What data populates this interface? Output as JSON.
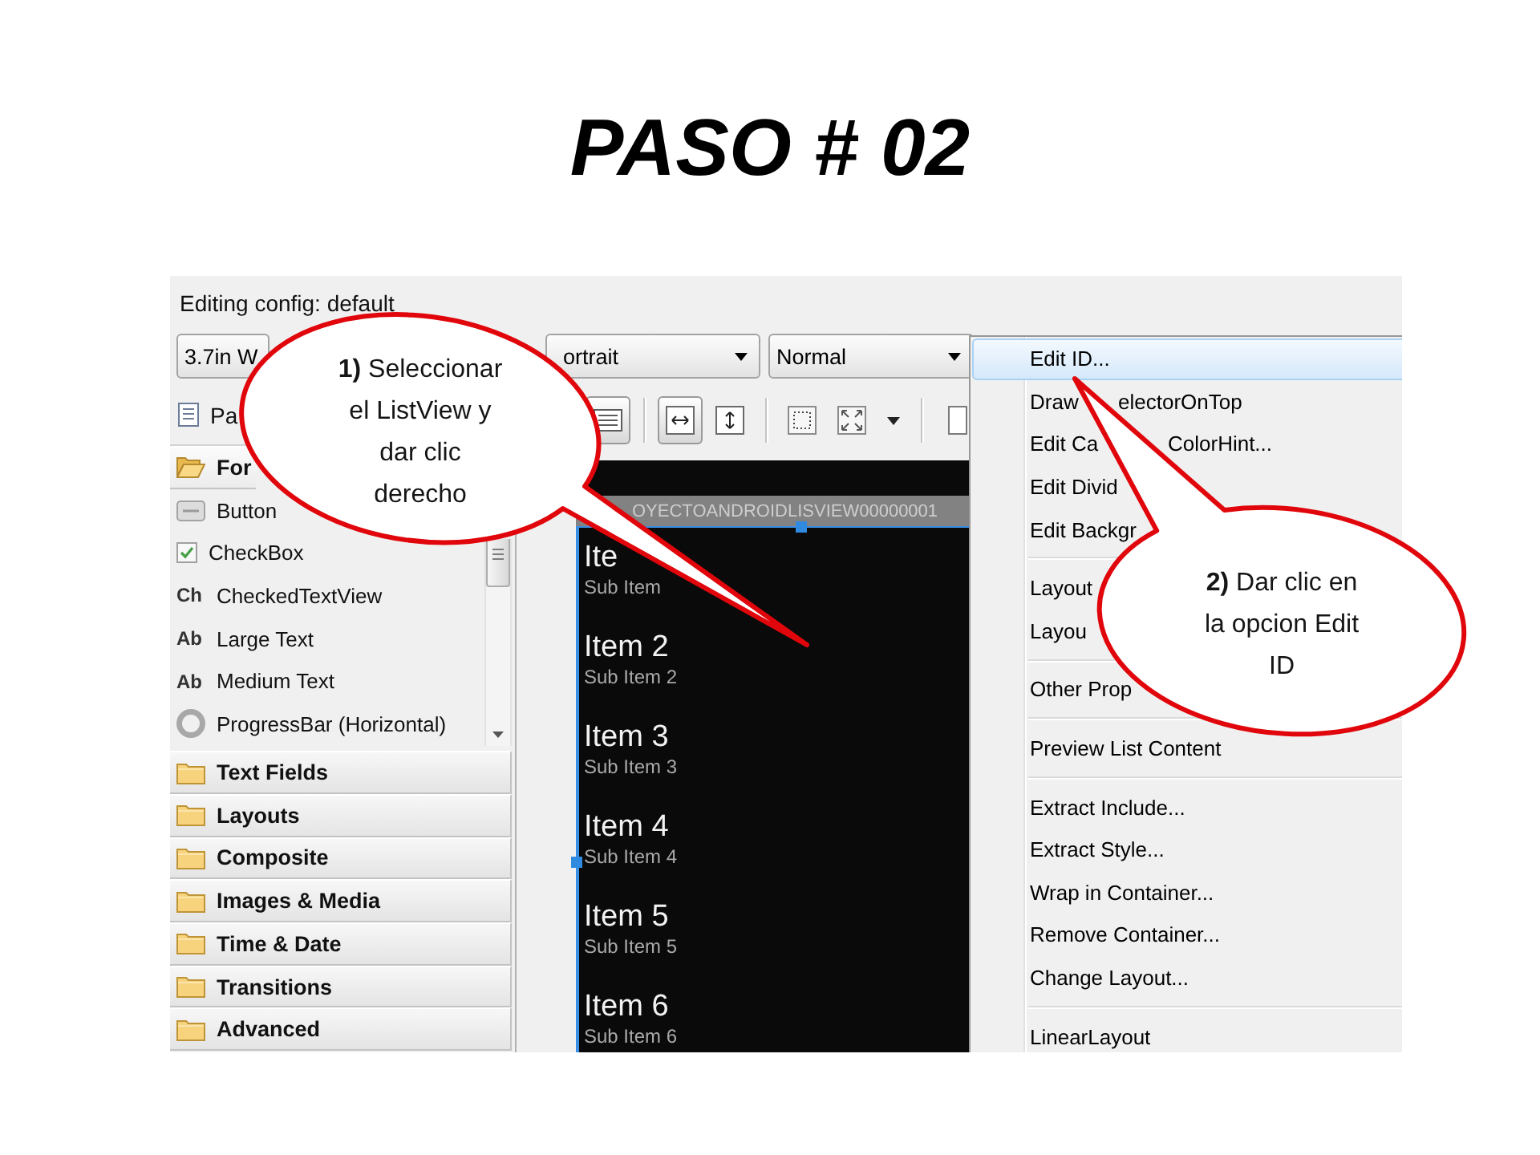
{
  "slide_title": "PASO # 02",
  "editor": {
    "config_label": "Editing config: default",
    "combos": [
      {
        "value": "3.7in W",
        "caret": false
      },
      {
        "value": "ortrait",
        "caret": true
      },
      {
        "value": "Normal",
        "caret": true
      }
    ],
    "palette": {
      "title": "Pa",
      "categories": [
        {
          "label": "For",
          "expanded": true,
          "items": [
            {
              "kind": "button",
              "label": "Button"
            },
            {
              "kind": "checkbox",
              "label": "CheckBox"
            },
            {
              "kind": "glyph",
              "icon_text": "Ch",
              "label": "CheckedTextView"
            },
            {
              "kind": "glyph",
              "icon_text": "Ab",
              "label": "Large Text"
            },
            {
              "kind": "glyph",
              "icon_text": "Ab",
              "label": "Medium Text"
            },
            {
              "kind": "ring",
              "label": "ProgressBar (Horizontal)"
            }
          ]
        },
        {
          "label": "Text Fields",
          "expanded": false
        },
        {
          "label": "Layouts",
          "expanded": false
        },
        {
          "label": "Composite",
          "expanded": false
        },
        {
          "label": "Images & Media",
          "expanded": false
        },
        {
          "label": "Time & Date",
          "expanded": false
        },
        {
          "label": "Transitions",
          "expanded": false
        },
        {
          "label": "Advanced",
          "expanded": false
        }
      ]
    },
    "toolbar": {
      "groups": [
        {
          "buttons": [
            {
              "kind": "list",
              "pressed": true
            }
          ]
        },
        {
          "buttons": [
            {
              "kind": "fit-width",
              "pressed": true
            },
            {
              "kind": "fit-height",
              "pressed": false
            }
          ]
        },
        {
          "buttons": [
            {
              "kind": "marquee",
              "pressed": false
            },
            {
              "kind": "expand",
              "pressed": false
            },
            {
              "kind": "caret",
              "pressed": false
            }
          ]
        },
        {
          "buttons": [
            {
              "kind": "frame",
              "pressed": false
            }
          ]
        }
      ]
    },
    "screen": {
      "title": "OYECTOANDROIDLISVIEW00000001",
      "list": {
        "selected": true,
        "items": [
          {
            "title": "Ite",
            "subtitle": "Sub Item"
          },
          {
            "title": "Item 2",
            "subtitle": "Sub Item 2"
          },
          {
            "title": "Item 3",
            "subtitle": "Sub Item 3"
          },
          {
            "title": "Item 4",
            "subtitle": "Sub Item 4"
          },
          {
            "title": "Item 5",
            "subtitle": "Sub Item 5"
          },
          {
            "title": "Item 6",
            "subtitle": "Sub Item 6"
          }
        ]
      }
    },
    "context_menu": {
      "items": [
        {
          "kind": "item",
          "label": "Edit ID...",
          "selected": true
        },
        {
          "kind": "item",
          "label": "Draw",
          "label_after": "electorOnTop",
          "selected": false
        },
        {
          "kind": "item",
          "label": "Edit Ca",
          "label_after": "ColorHint...",
          "selected": false
        },
        {
          "kind": "item",
          "label": "Edit Divid",
          "selected": false
        },
        {
          "kind": "item",
          "label": "Edit Backgr",
          "selected": false
        },
        {
          "kind": "separator"
        },
        {
          "kind": "item",
          "label": "Layout",
          "selected": false
        },
        {
          "kind": "item",
          "label": "Layou",
          "selected": false
        },
        {
          "kind": "separator"
        },
        {
          "kind": "item",
          "label": "Other Prop",
          "selected": false
        },
        {
          "kind": "separator"
        },
        {
          "kind": "item",
          "label": "Preview List Content",
          "selected": false
        },
        {
          "kind": "separator"
        },
        {
          "kind": "item",
          "label": "Extract Include...",
          "selected": false
        },
        {
          "kind": "item",
          "label": "Extract Style...",
          "selected": false
        },
        {
          "kind": "item",
          "label": "Wrap in Container...",
          "selected": false
        },
        {
          "kind": "item",
          "label": "Remove Container...",
          "selected": false
        },
        {
          "kind": "item",
          "label": "Change Layout...",
          "selected": false
        },
        {
          "kind": "separator"
        },
        {
          "kind": "item",
          "label": "LinearLayout",
          "selected": false
        }
      ]
    }
  },
  "callouts": [
    {
      "text": "**1)** Seleccionar\nel ListView y\ndar clic\nderecho"
    },
    {
      "text": "**2)** Dar clic en\nla opcion Edit\nID"
    }
  ]
}
